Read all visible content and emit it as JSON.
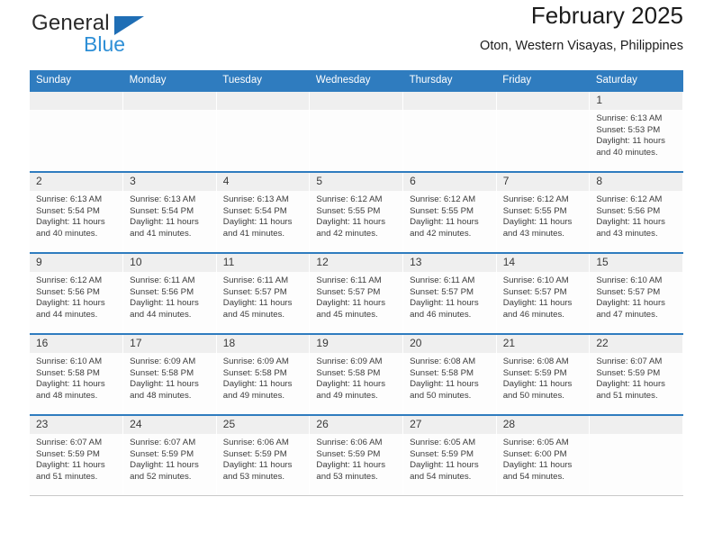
{
  "brand": {
    "name_dark": "General",
    "name_blue": "Blue",
    "triangle_color": "#1f6eb5",
    "blue_color": "#2e8fd6"
  },
  "header": {
    "title": "February 2025",
    "subtitle": "Oton, Western Visayas, Philippines"
  },
  "theme": {
    "header_bg": "#2f7cbf",
    "daynum_bg": "#efefef",
    "cell_bg": "#fdfdfd"
  },
  "weekdays": [
    "Sunday",
    "Monday",
    "Tuesday",
    "Wednesday",
    "Thursday",
    "Friday",
    "Saturday"
  ],
  "labels": {
    "sunrise": "Sunrise:",
    "sunset": "Sunset:",
    "daylight": "Daylight:"
  },
  "weeks": [
    [
      {
        "empty": true
      },
      {
        "empty": true
      },
      {
        "empty": true
      },
      {
        "empty": true
      },
      {
        "empty": true
      },
      {
        "empty": true
      },
      {
        "day": "1",
        "sunrise": "Sunrise: 6:13 AM",
        "sunset": "Sunset: 5:53 PM",
        "daylight": "Daylight: 11 hours and 40 minutes."
      }
    ],
    [
      {
        "day": "2",
        "sunrise": "Sunrise: 6:13 AM",
        "sunset": "Sunset: 5:54 PM",
        "daylight": "Daylight: 11 hours and 40 minutes."
      },
      {
        "day": "3",
        "sunrise": "Sunrise: 6:13 AM",
        "sunset": "Sunset: 5:54 PM",
        "daylight": "Daylight: 11 hours and 41 minutes."
      },
      {
        "day": "4",
        "sunrise": "Sunrise: 6:13 AM",
        "sunset": "Sunset: 5:54 PM",
        "daylight": "Daylight: 11 hours and 41 minutes."
      },
      {
        "day": "5",
        "sunrise": "Sunrise: 6:12 AM",
        "sunset": "Sunset: 5:55 PM",
        "daylight": "Daylight: 11 hours and 42 minutes."
      },
      {
        "day": "6",
        "sunrise": "Sunrise: 6:12 AM",
        "sunset": "Sunset: 5:55 PM",
        "daylight": "Daylight: 11 hours and 42 minutes."
      },
      {
        "day": "7",
        "sunrise": "Sunrise: 6:12 AM",
        "sunset": "Sunset: 5:55 PM",
        "daylight": "Daylight: 11 hours and 43 minutes."
      },
      {
        "day": "8",
        "sunrise": "Sunrise: 6:12 AM",
        "sunset": "Sunset: 5:56 PM",
        "daylight": "Daylight: 11 hours and 43 minutes."
      }
    ],
    [
      {
        "day": "9",
        "sunrise": "Sunrise: 6:12 AM",
        "sunset": "Sunset: 5:56 PM",
        "daylight": "Daylight: 11 hours and 44 minutes."
      },
      {
        "day": "10",
        "sunrise": "Sunrise: 6:11 AM",
        "sunset": "Sunset: 5:56 PM",
        "daylight": "Daylight: 11 hours and 44 minutes."
      },
      {
        "day": "11",
        "sunrise": "Sunrise: 6:11 AM",
        "sunset": "Sunset: 5:57 PM",
        "daylight": "Daylight: 11 hours and 45 minutes."
      },
      {
        "day": "12",
        "sunrise": "Sunrise: 6:11 AM",
        "sunset": "Sunset: 5:57 PM",
        "daylight": "Daylight: 11 hours and 45 minutes."
      },
      {
        "day": "13",
        "sunrise": "Sunrise: 6:11 AM",
        "sunset": "Sunset: 5:57 PM",
        "daylight": "Daylight: 11 hours and 46 minutes."
      },
      {
        "day": "14",
        "sunrise": "Sunrise: 6:10 AM",
        "sunset": "Sunset: 5:57 PM",
        "daylight": "Daylight: 11 hours and 46 minutes."
      },
      {
        "day": "15",
        "sunrise": "Sunrise: 6:10 AM",
        "sunset": "Sunset: 5:57 PM",
        "daylight": "Daylight: 11 hours and 47 minutes."
      }
    ],
    [
      {
        "day": "16",
        "sunrise": "Sunrise: 6:10 AM",
        "sunset": "Sunset: 5:58 PM",
        "daylight": "Daylight: 11 hours and 48 minutes."
      },
      {
        "day": "17",
        "sunrise": "Sunrise: 6:09 AM",
        "sunset": "Sunset: 5:58 PM",
        "daylight": "Daylight: 11 hours and 48 minutes."
      },
      {
        "day": "18",
        "sunrise": "Sunrise: 6:09 AM",
        "sunset": "Sunset: 5:58 PM",
        "daylight": "Daylight: 11 hours and 49 minutes."
      },
      {
        "day": "19",
        "sunrise": "Sunrise: 6:09 AM",
        "sunset": "Sunset: 5:58 PM",
        "daylight": "Daylight: 11 hours and 49 minutes."
      },
      {
        "day": "20",
        "sunrise": "Sunrise: 6:08 AM",
        "sunset": "Sunset: 5:58 PM",
        "daylight": "Daylight: 11 hours and 50 minutes."
      },
      {
        "day": "21",
        "sunrise": "Sunrise: 6:08 AM",
        "sunset": "Sunset: 5:59 PM",
        "daylight": "Daylight: 11 hours and 50 minutes."
      },
      {
        "day": "22",
        "sunrise": "Sunrise: 6:07 AM",
        "sunset": "Sunset: 5:59 PM",
        "daylight": "Daylight: 11 hours and 51 minutes."
      }
    ],
    [
      {
        "day": "23",
        "sunrise": "Sunrise: 6:07 AM",
        "sunset": "Sunset: 5:59 PM",
        "daylight": "Daylight: 11 hours and 51 minutes."
      },
      {
        "day": "24",
        "sunrise": "Sunrise: 6:07 AM",
        "sunset": "Sunset: 5:59 PM",
        "daylight": "Daylight: 11 hours and 52 minutes."
      },
      {
        "day": "25",
        "sunrise": "Sunrise: 6:06 AM",
        "sunset": "Sunset: 5:59 PM",
        "daylight": "Daylight: 11 hours and 53 minutes."
      },
      {
        "day": "26",
        "sunrise": "Sunrise: 6:06 AM",
        "sunset": "Sunset: 5:59 PM",
        "daylight": "Daylight: 11 hours and 53 minutes."
      },
      {
        "day": "27",
        "sunrise": "Sunrise: 6:05 AM",
        "sunset": "Sunset: 5:59 PM",
        "daylight": "Daylight: 11 hours and 54 minutes."
      },
      {
        "day": "28",
        "sunrise": "Sunrise: 6:05 AM",
        "sunset": "Sunset: 6:00 PM",
        "daylight": "Daylight: 11 hours and 54 minutes."
      },
      {
        "empty": true
      }
    ]
  ]
}
